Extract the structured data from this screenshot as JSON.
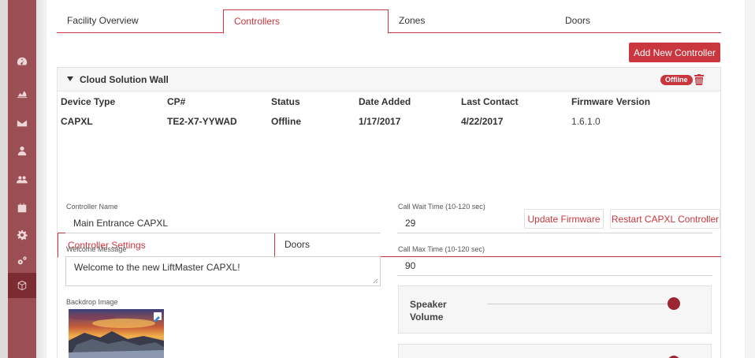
{
  "nav": {
    "tabs": [
      {
        "label": "Facility Overview"
      },
      {
        "label": "Controllers"
      },
      {
        "label": "Zones"
      },
      {
        "label": "Doors"
      }
    ],
    "active": "Controllers"
  },
  "sidebar": {
    "items": [
      {
        "icon": "dashboard-icon"
      },
      {
        "icon": "chart-icon"
      },
      {
        "icon": "envelope-icon"
      },
      {
        "icon": "user-icon"
      },
      {
        "icon": "users-icon"
      },
      {
        "icon": "calendar-icon"
      },
      {
        "icon": "gear-icon"
      },
      {
        "icon": "gears-icon"
      },
      {
        "icon": "cube-icon"
      }
    ],
    "active_icon": "cube-icon"
  },
  "actions": {
    "add_controller": "Add New Controller"
  },
  "controller": {
    "name": "Cloud Solution Wall",
    "status_badge": "Offline",
    "columns": {
      "device_type": "Device Type",
      "cp": "CP#",
      "status": "Status",
      "date_added": "Date Added",
      "last_contact": "Last Contact",
      "firmware": "Firmware Version"
    },
    "row": {
      "device_type": "CAPXL",
      "cp": "TE2-X7-YYWAD",
      "status": "Offline",
      "date_added": "1/17/2017",
      "last_contact": "4/22/2017",
      "firmware": "1.6.1.0"
    },
    "buttons": {
      "update_firmware": "Update Firmware",
      "restart": "Restart CAPXL Controller"
    }
  },
  "settings_tabs": [
    {
      "label": "Controller Settings"
    },
    {
      "label": "Doors"
    }
  ],
  "settings": {
    "controller_name_label": "Controller Name",
    "controller_name": "Main Entrance CAPXL",
    "welcome_label": "Welcome Message",
    "welcome_message": "Welcome to the new LiftMaster CAPXL!",
    "backdrop_label": "Backdrop Image",
    "call_wait_label": "Call Wait Time (10-120 sec)",
    "call_wait": "29",
    "call_max_label": "Call Max Time (10-120 sec)",
    "call_max": "90",
    "speaker_volume_label": "Speaker Volume",
    "speaker_volume_level": 1.0,
    "second_slider_level": 1.0
  },
  "colors": {
    "accent": "#c9363e",
    "sidebar": "#9b4f55",
    "sidebar_active": "#7c2b33",
    "knob": "#9b2630"
  }
}
